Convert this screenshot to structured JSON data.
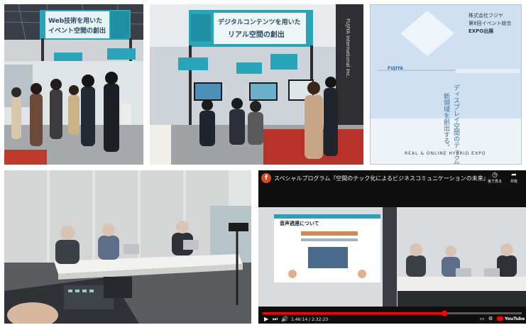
{
  "photos": {
    "booth_left": {
      "banner_line1": "Web技術を用いた",
      "banner_line2": "イベント空間の創出"
    },
    "booth_right": {
      "banner_line1": "デジタルコンテンツを用いた",
      "banner_line2": "リアル空間の創出",
      "pillar_text": "FUJIYA International Inc."
    },
    "poster": {
      "company": "株式会社フジヤ",
      "event_line1": "第8回イベント総合",
      "event_line2": "EXPO出展",
      "logo": "FUJIYA",
      "vertical_line1": "ディスプレイ空間のテック化、",
      "vertical_line2": "新領域を創出する。",
      "footer": "REAL & ONLINE HYBRID EXPO"
    },
    "video": {
      "channel_initial": "f",
      "title": "スペシャルプログラム『空間のテック化によるビジネスコミュニケーションの未来』",
      "watch_later": "後で見る",
      "share": "共有",
      "slide_title": "音声週連について",
      "time": "1:46:14 / 2:32:23",
      "brand": "YouTube"
    }
  },
  "colors": {
    "teal": "#2f9fb4",
    "navy": "#1d2d4a",
    "poster_bg": "#cfe0f2",
    "youtube_red": "#ff0000"
  }
}
